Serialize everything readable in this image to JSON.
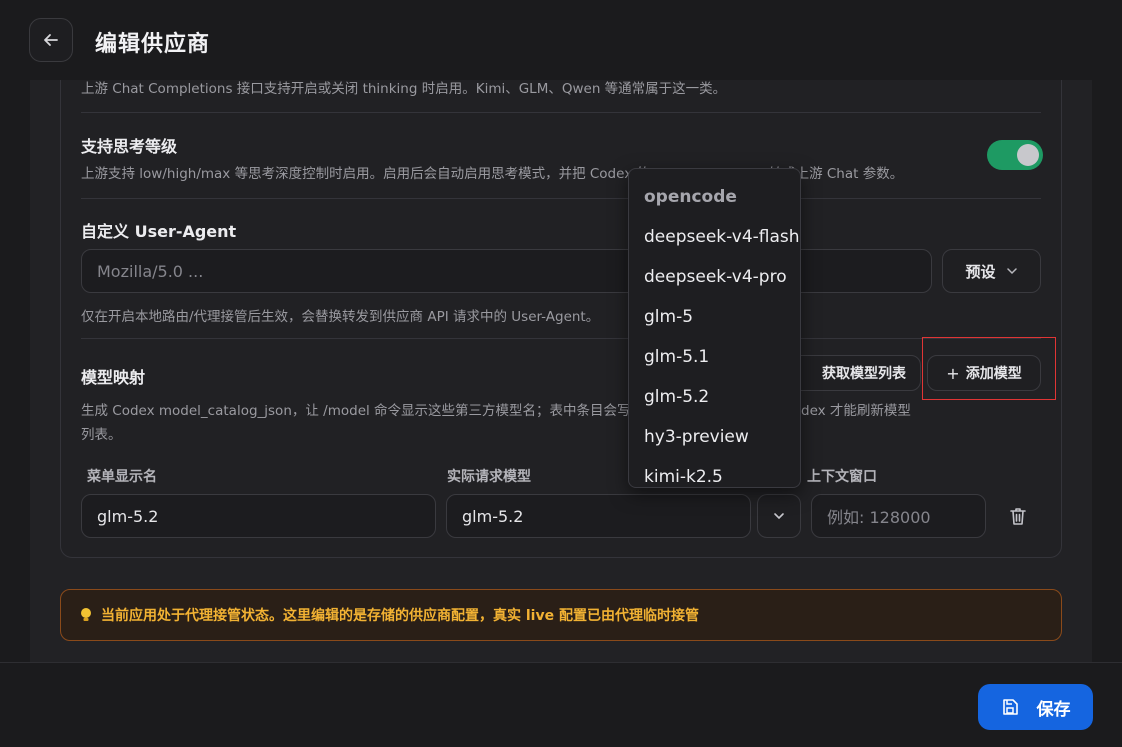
{
  "header": {
    "title": "编辑供应商"
  },
  "settings": {
    "thinking_toggle_desc": "上游 Chat Completions 接口支持开启或关闭 thinking 时启用。Kimi、GLM、Qwen 等通常属于这一类。",
    "thinking_level_title": "支持思考等级",
    "thinking_level_desc": "上游支持 low/high/max 等思考深度控制时启用。启用后会自动启用思考模式，并把 Codex 的 reasoning_effort 转成上游 Chat 参数。",
    "ua_title": "自定义 User-Agent",
    "ua_placeholder": "Mozilla/5.0 ...",
    "ua_preset_label": "预设",
    "ua_desc": "仅在开启本地路由/代理接管后生效，会替换转发到供应商 API 请求中的 User-Agent。"
  },
  "model_mapping": {
    "title": "模型映射",
    "fetch_button": "获取模型列表",
    "add_button": "添加模型",
    "desc_line1": "生成 Codex model_catalog_json，让 /model 命令显示这些第三方模型名；表中条目会写入配置，修改后需要重启 Codex 才能刷新模型",
    "desc_line2": "列表。",
    "columns": [
      "菜单显示名",
      "实际请求模型",
      "上下文窗口"
    ],
    "row": {
      "display_name": "glm-5.2",
      "request_model": "glm-5.2",
      "context_placeholder": "例如: 128000"
    }
  },
  "dropdown": {
    "group": "opencode",
    "items": [
      "deepseek-v4-flash",
      "deepseek-v4-pro",
      "glm-5",
      "glm-5.1",
      "glm-5.2",
      "hy3-preview",
      "kimi-k2.5"
    ]
  },
  "notice": {
    "icon": "lightbulb-icon",
    "text": "当前应用处于代理接管状态。这里编辑的是存储的供应商配置，真实 live 配置已由代理临时接管"
  },
  "footer": {
    "save_label": "保存"
  },
  "colors": {
    "accent": "#1565e0",
    "toggle_on": "#1e9a63",
    "warning": "#f2b233",
    "highlight": "#e03535"
  }
}
